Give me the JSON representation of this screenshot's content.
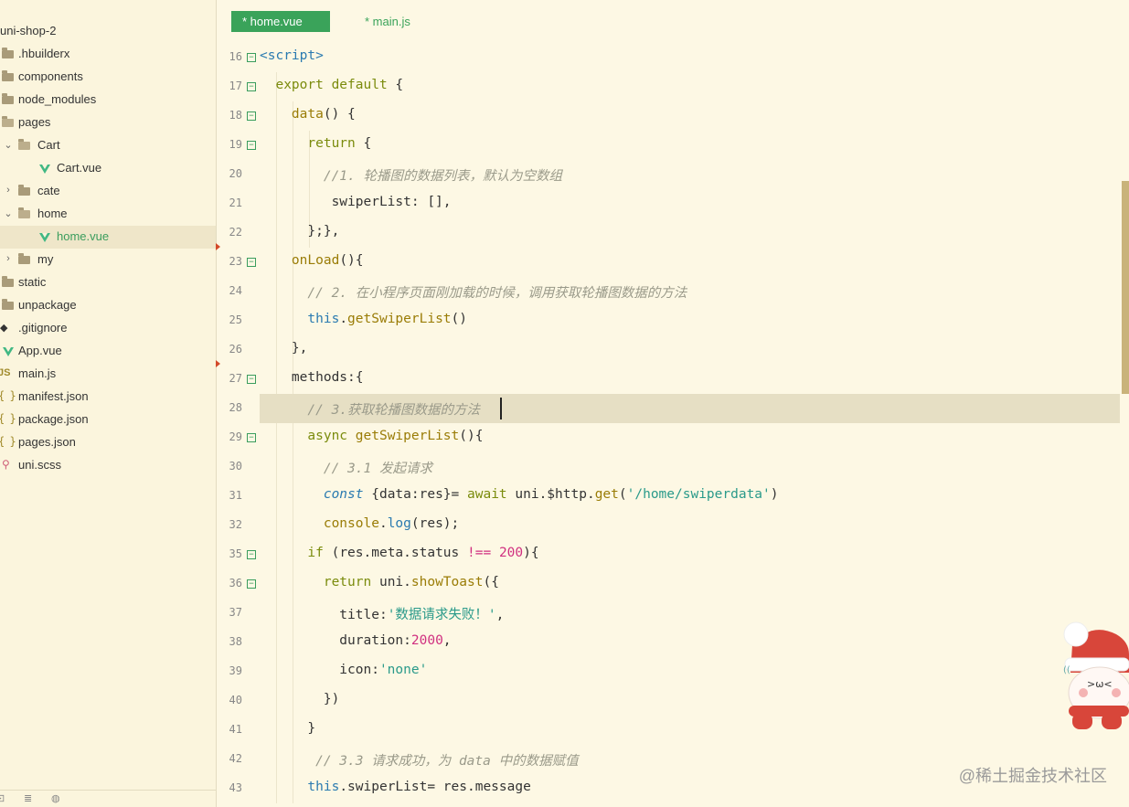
{
  "explorer": {
    "items": [
      {
        "label": "uni-shop-2",
        "kind": "root"
      },
      {
        "label": ".hbuilderx",
        "kind": "folder"
      },
      {
        "label": "components",
        "kind": "folder"
      },
      {
        "label": "node_modules",
        "kind": "folder"
      },
      {
        "label": "pages",
        "kind": "folder-open"
      },
      {
        "label": "Cart",
        "kind": "folder-open"
      },
      {
        "label": "Cart.vue",
        "kind": "vue"
      },
      {
        "label": "cate",
        "kind": "folder-closed"
      },
      {
        "label": "home",
        "kind": "folder-open"
      },
      {
        "label": "home.vue",
        "kind": "vue",
        "selected": true
      },
      {
        "label": "my",
        "kind": "folder-closed"
      },
      {
        "label": "static",
        "kind": "folder"
      },
      {
        "label": "unpackage",
        "kind": "folder"
      },
      {
        "label": ".gitignore",
        "kind": "git"
      },
      {
        "label": "App.vue",
        "kind": "vue"
      },
      {
        "label": "main.js",
        "kind": "js"
      },
      {
        "label": "manifest.json",
        "kind": "json"
      },
      {
        "label": "package.json",
        "kind": "json"
      },
      {
        "label": "pages.json",
        "kind": "json"
      },
      {
        "label": "uni.scss",
        "kind": "scss"
      }
    ],
    "icons": {
      "js": "JS",
      "json": "{ }",
      "git": "◆",
      "scss": "⚲"
    }
  },
  "tabs": [
    {
      "label": "* home.vue",
      "active": true
    },
    {
      "label": "* main.js",
      "active": false
    }
  ],
  "code": [
    {
      "line": "16",
      "fold": "⊟",
      "html": "<span class=\"tag\">&lt;script&gt;</span>"
    },
    {
      "line": "17",
      "fold": "⊟",
      "html": "  <span class=\"kw\">export default</span> {"
    },
    {
      "line": "18",
      "fold": "⊟",
      "html": "    <span class=\"fn\">data</span>() {"
    },
    {
      "line": "19",
      "fold": "⊟",
      "html": "      <span class=\"kw\">return</span> {"
    },
    {
      "line": "20",
      "fold": "",
      "html": "        <span class=\"cmt\">//1. 轮播图的数据列表，默认为空数组</span>"
    },
    {
      "line": "21",
      "fold": "",
      "html": "         swiperList: [],"
    },
    {
      "line": "22",
      "fold": "",
      "html": "      };},"
    },
    {
      "line": "23",
      "fold": "⊟",
      "html": "    <span class=\"fn\">onLoad</span>(){"
    },
    {
      "line": "24",
      "fold": "",
      "html": "      <span class=\"cmt\">// 2. 在小程序页面刚加载的时候，调用获取轮播图数据的方法</span>"
    },
    {
      "line": "25",
      "fold": "",
      "html": "      <span class=\"kw2\">this</span>.<span class=\"fn\">getSwiperList</span>()"
    },
    {
      "line": "26",
      "fold": "",
      "html": "    },"
    },
    {
      "line": "27",
      "fold": "⊟",
      "html": "    methods:{"
    },
    {
      "line": "28",
      "fold": "",
      "html": "      <span class=\"cmt\">// 3.获取轮播图数据的方法</span>",
      "current": true
    },
    {
      "line": "29",
      "fold": "⊟",
      "html": "      <span class=\"kw\">async</span> <span class=\"fn\">getSwiperList</span>(){"
    },
    {
      "line": "30",
      "fold": "",
      "html": "        <span class=\"cmt\">// 3.1 发起请求</span>"
    },
    {
      "line": "31",
      "fold": "",
      "html": "        <span class=\"kw2\" style=\"font-style:italic\">const</span> {data:res}= <span class=\"kw\">await</span> uni.$http.<span class=\"fn\">get</span>(<span class=\"str\">'/home/swiperdata'</span>)"
    },
    {
      "line": "32",
      "fold": "",
      "html": "        <span class=\"fn\">console</span>.<span class=\"kw2\">log</span>(res);"
    },
    {
      "line": "35",
      "fold": "⊟",
      "html": "      <span class=\"kw\">if</span> (res.meta.status <span class=\"num\">!==</span> <span class=\"num\">200</span>){"
    },
    {
      "line": "36",
      "fold": "⊟",
      "html": "        <span class=\"kw\">return</span> uni.<span class=\"fn\">showToast</span>({"
    },
    {
      "line": "37",
      "fold": "",
      "html": "          title:<span class=\"str\">'数据请求失败！'</span>,"
    },
    {
      "line": "38",
      "fold": "",
      "html": "          duration:<span class=\"num\">2000</span>,"
    },
    {
      "line": "39",
      "fold": "",
      "html": "          icon:<span class=\"str\">'none'</span>"
    },
    {
      "line": "40",
      "fold": "",
      "html": "        })"
    },
    {
      "line": "41",
      "fold": "",
      "html": "      }"
    },
    {
      "line": "42",
      "fold": "",
      "html": "       <span class=\"cmt\">// 3.3 请求成功，为 data 中的数据赋值</span>"
    },
    {
      "line": "43",
      "fold": "",
      "html": "      <span class=\"kw2\">this</span>.swiperList= res.message"
    }
  ],
  "footer": {
    "icons": [
      "layout-icon",
      "search-list-icon",
      "globe-icon"
    ],
    "glyphs": [
      "⊡",
      "≣",
      "◍"
    ]
  },
  "watermark": "@稀土掘金技术社区"
}
